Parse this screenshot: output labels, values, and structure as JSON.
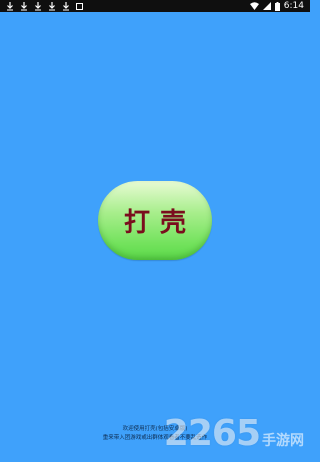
{
  "status_bar": {
    "time": "6:14",
    "icons": [
      "download-icon",
      "download-icon",
      "download-icon",
      "download-icon",
      "download-icon",
      "notification-box-icon",
      "wifi-icon",
      "signal-icon",
      "battery-icon"
    ]
  },
  "main": {
    "button_label": "打壳",
    "button_color_top": "#e8fbd4",
    "button_color_bottom": "#5cd94a",
    "label_color": "#7a0d1d",
    "background": "#3fa1fb"
  },
  "footer": {
    "line1": "欢迎使用打壳(包括安卓版)",
    "line2": "重来带入团游戏或出群体观看者不要乱造作"
  },
  "watermark": {
    "digits": "2265",
    "text": "手游网"
  }
}
